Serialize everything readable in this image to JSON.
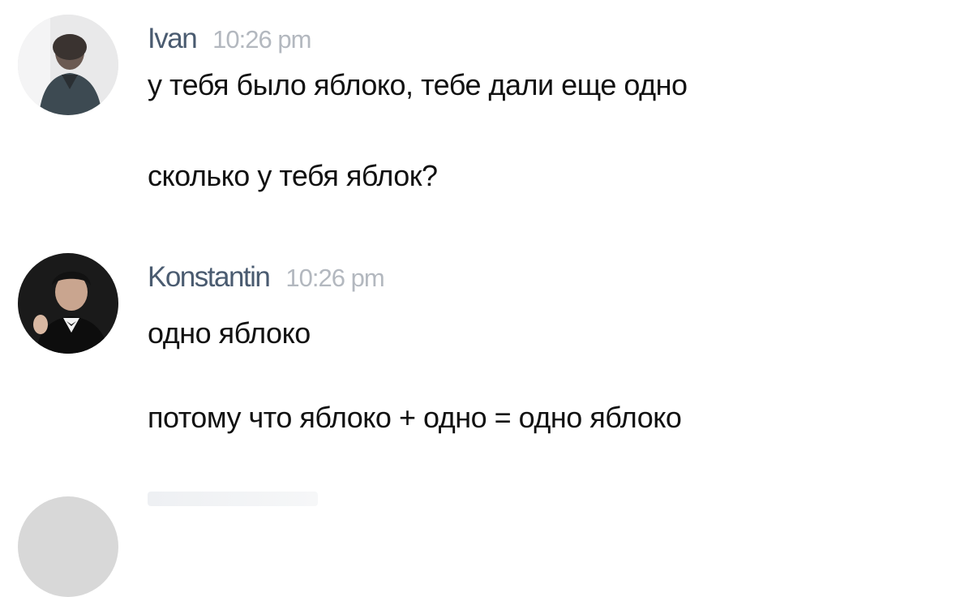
{
  "messages": [
    {
      "author": "Ivan",
      "time": "10:26 pm",
      "lines": [
        "у тебя было яблоко, тебе дали еще одно",
        "сколько у тебя яблок?"
      ],
      "avatar_icon": "user-photo-icon"
    },
    {
      "author": "Konstantin",
      "time": "10:26 pm",
      "lines": [
        "одно яблоко",
        "потому что яблоко + одно = одно яблоко"
      ],
      "avatar_icon": "user-photo-icon"
    }
  ],
  "colors": {
    "author_name": "#4a5b70",
    "timestamp": "#b3b8bf",
    "message_text": "#111111",
    "background": "#ffffff"
  }
}
